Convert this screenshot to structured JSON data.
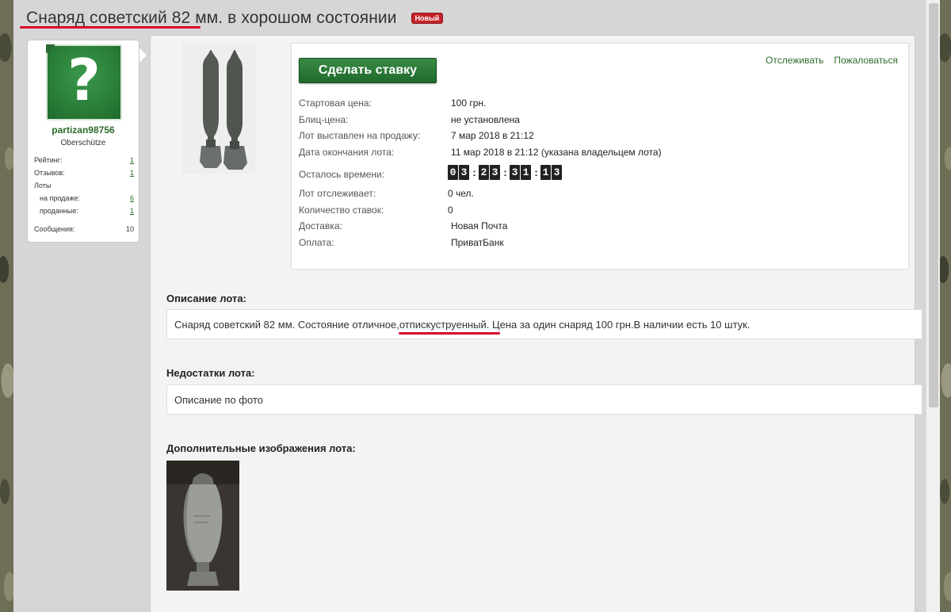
{
  "lot": {
    "title": "Снаряд советский 82 мм. в хорошом состоянии",
    "badge": "Новый"
  },
  "seller": {
    "username": "partizan98756",
    "rank": "Oberschütze",
    "stats": [
      {
        "label": "Рейтинг:",
        "value": "1",
        "link": true,
        "sub": false
      },
      {
        "label": "Отзывов:",
        "value": "1",
        "link": true,
        "sub": false
      },
      {
        "label": "Лоты",
        "value": "",
        "link": false,
        "sub": false
      },
      {
        "label": "на продаже:",
        "value": "6",
        "link": true,
        "sub": true
      },
      {
        "label": "проданные:",
        "value": "1",
        "link": true,
        "sub": true
      },
      {
        "label": "Сообщения:",
        "value": "10",
        "link": false,
        "sub": false
      }
    ]
  },
  "actions": {
    "bid_label": "Сделать ставку",
    "watch_label": "Отслеживать",
    "report_label": "Пожаловаться"
  },
  "details": {
    "start_price_label": "Стартовая цена:",
    "start_price": "100 грн.",
    "blitz_label": "Блиц-цена:",
    "blitz": "не установлена",
    "listed_label": "Лот выставлен на продажу:",
    "listed": "7 мар 2018 в 21:12",
    "end_label": "Дата окончания лота:",
    "end": "11 мар 2018 в 21:12 (указана владельцем лота)",
    "remaining_label": "Осталось времени:",
    "timer": [
      "03",
      "23",
      "31",
      "13"
    ],
    "watchers_label": "Лот отслеживает:",
    "watchers": "0 чел.",
    "bids_label": "Количество ставок:",
    "bids": "0",
    "delivery_label": "Доставка:",
    "delivery": "Новая Почта",
    "payment_label": "Оплата:",
    "payment": "ПриватБанк"
  },
  "description": {
    "title": "Описание лота:",
    "text": "Снаряд советский 82 мм. Состояние отличное,отпискуструенный. Цена за один снаряд 100 грн.В наличии есть 10 штук."
  },
  "defects": {
    "title": "Недостатки лота:",
    "text": "Описание по фото"
  },
  "extra_images": {
    "title": "Дополнительные изображения лота:"
  },
  "colors": {
    "accent_green": "#2e6b2e",
    "badge_red": "#c4242b",
    "highlight_red": "#d9002a"
  }
}
